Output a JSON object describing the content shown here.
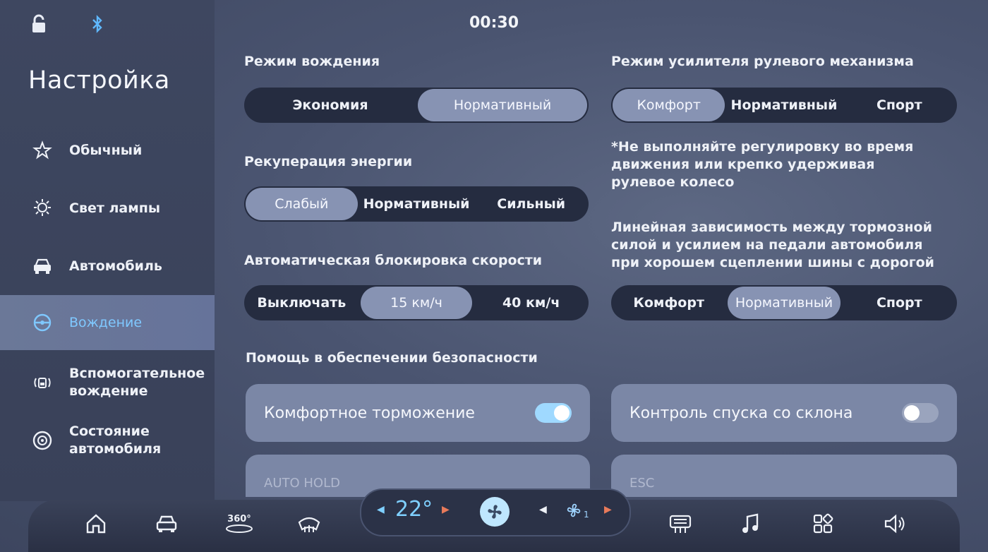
{
  "status": {
    "time": "00:30"
  },
  "sidebar": {
    "title": "Настройка",
    "items": [
      {
        "label": "Обычный",
        "icon": "star-icon"
      },
      {
        "label": "Свет лампы",
        "icon": "light-icon"
      },
      {
        "label": "Автомобиль",
        "icon": "car-icon"
      },
      {
        "label": "Вождение",
        "icon": "steering-wheel-icon",
        "active": true
      },
      {
        "label": "Вспомогательное вождение",
        "icon": "assist-icon"
      },
      {
        "label": "Состояние автомобиля",
        "icon": "wheel-icon"
      }
    ]
  },
  "drive_mode": {
    "title": "Режим вождения",
    "options": [
      "Экономия",
      "Нормативный"
    ],
    "selected": 1
  },
  "energy_recovery": {
    "title": "Рекуперация энергии",
    "options": [
      "Слабый",
      "Нормативный",
      "Сильный"
    ],
    "selected": 0
  },
  "auto_lock": {
    "title": "Автоматическая блокировка скорости",
    "options": [
      "Выключать",
      "15 км/ч",
      "40 км/ч"
    ],
    "selected": 1
  },
  "steering_mode": {
    "title": "Режим усилителя рулевого механизма",
    "options": [
      "Комфорт",
      "Нормативный",
      "Спорт"
    ],
    "selected": 0,
    "note": "*Не выполняйте регулировку во время движения или крепко удерживая рулевое колесо"
  },
  "brake_mode": {
    "description": "Линейная зависимость между тормозной силой и усилием на педали автомобиля при хорошем сцеплении шины с дорогой",
    "options": [
      "Комфорт",
      "Нормативный",
      "Спорт"
    ],
    "selected": 1
  },
  "safety": {
    "title": "Помощь в обеспечении безопасности",
    "comfort_braking": {
      "label": "Комфортное торможение",
      "on": true
    },
    "hill_descent": {
      "label": "Контроль спуска со склона",
      "on": false
    },
    "auto_hold": {
      "label": "AUTO HOLD"
    },
    "esc": {
      "label": "ESC"
    }
  },
  "dock": {
    "temperature": "22°",
    "fan_level": "1",
    "camera_label": "360°",
    "accent": "#7fd0ff"
  }
}
